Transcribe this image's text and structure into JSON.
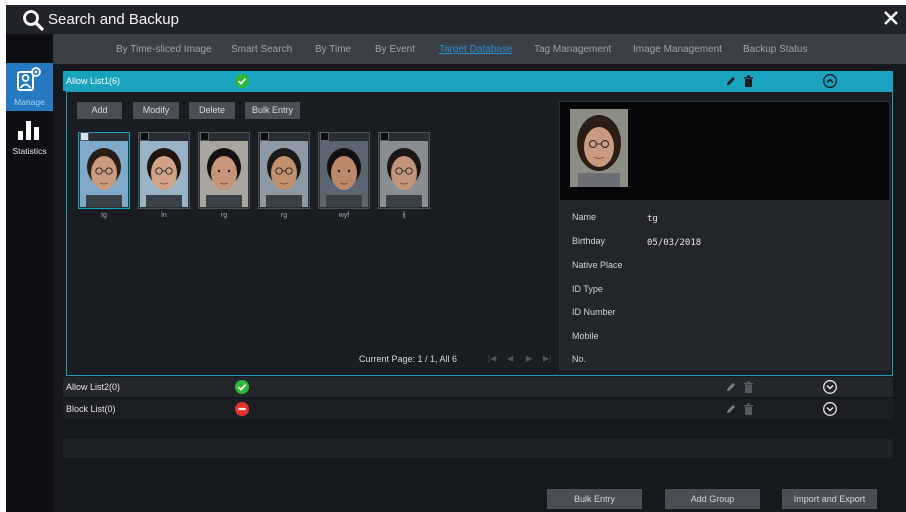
{
  "window": {
    "title": "Search and Backup"
  },
  "tabs": [
    {
      "label": "By Time-sliced Image",
      "active": false
    },
    {
      "label": "Smart Search",
      "active": false
    },
    {
      "label": "By Time",
      "active": false
    },
    {
      "label": "By Event",
      "active": false
    },
    {
      "label": "Target Database",
      "active": true
    },
    {
      "label": "Tag Management",
      "active": false
    },
    {
      "label": "Image Management",
      "active": false
    },
    {
      "label": "Backup Status",
      "active": false
    }
  ],
  "sidebar": [
    {
      "label": "Manage",
      "icon": "manage-icon",
      "active": true
    },
    {
      "label": "Statistics",
      "icon": "bar-chart-icon",
      "active": false
    }
  ],
  "lists": [
    {
      "name": "Allow List1(6)",
      "status": "allow",
      "expanded": true
    },
    {
      "name": "Allow List2(0)",
      "status": "allow",
      "expanded": false
    },
    {
      "name": "Block List(0)",
      "status": "block",
      "expanded": false
    }
  ],
  "toolbar": {
    "add": "Add",
    "modify": "Modify",
    "delete": "Delete",
    "bulk_entry": "Bulk Entry"
  },
  "faces": [
    {
      "name": "tg",
      "checked": true
    },
    {
      "name": "ln",
      "checked": false
    },
    {
      "name": "rg",
      "checked": false
    },
    {
      "name": "rg",
      "checked": false
    },
    {
      "name": "wyf",
      "checked": false
    },
    {
      "name": "lj",
      "checked": false
    }
  ],
  "pager": {
    "text": "Current Page: 1 / 1, All 6"
  },
  "detail": {
    "fields": [
      {
        "label": "Name",
        "value": "tg"
      },
      {
        "label": "Birthday",
        "value": "05/03/2018"
      },
      {
        "label": "Native Place",
        "value": ""
      },
      {
        "label": "ID Type",
        "value": ""
      },
      {
        "label": "ID Number",
        "value": ""
      },
      {
        "label": "Mobile",
        "value": ""
      },
      {
        "label": "No.",
        "value": ""
      }
    ]
  },
  "bottom": {
    "bulk_entry": "Bulk Entry",
    "add_group": "Add Group",
    "import_export": "Import and Export"
  },
  "colors": {
    "accent": "#1aa3bf",
    "sidebar_active": "#2679c1",
    "allow": "#2fb737",
    "block": "#e0342d",
    "tab_active": "#2b8fd4"
  }
}
